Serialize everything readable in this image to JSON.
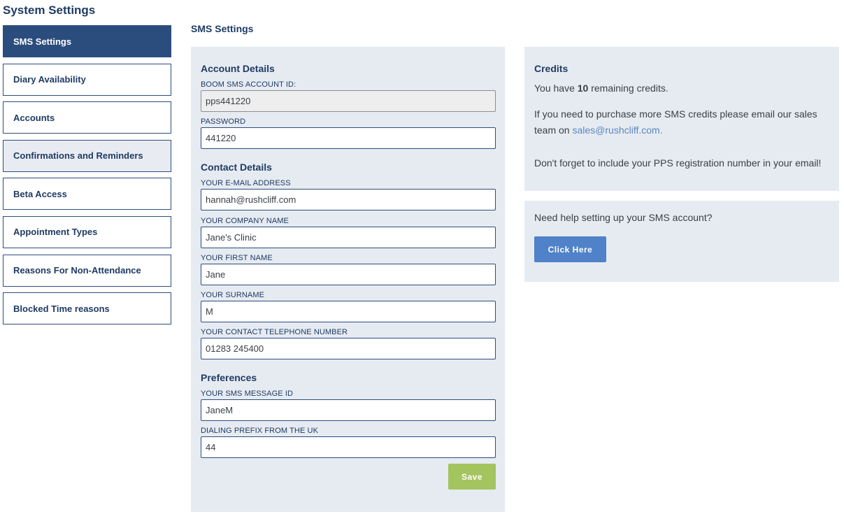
{
  "page": {
    "title": "System Settings"
  },
  "sidebar": {
    "items": [
      {
        "label": "SMS Settings"
      },
      {
        "label": "Diary Availability"
      },
      {
        "label": "Accounts"
      },
      {
        "label": "Confirmations and Reminders"
      },
      {
        "label": "Beta Access"
      },
      {
        "label": "Appointment Types"
      },
      {
        "label": "Reasons For Non-Attendance"
      },
      {
        "label": "Blocked Time reasons"
      }
    ]
  },
  "main": {
    "section_title": "SMS Settings"
  },
  "form": {
    "account_title": "Account Details",
    "account_id_label": "BOOM SMS ACCOUNT ID:",
    "account_id_value": "pps441220",
    "password_label": "PASSWORD",
    "password_value": "441220",
    "contact_title": "Contact Details",
    "email_label": "YOUR E-MAIL ADDRESS",
    "email_value": "hannah@rushcliff.com",
    "company_label": "YOUR COMPANY NAME",
    "company_value": "Jane's Clinic",
    "first_name_label": "YOUR FIRST NAME",
    "first_name_value": "Jane",
    "surname_label": "YOUR SURNAME",
    "surname_value": "M",
    "phone_label": "YOUR CONTACT TELEPHONE NUMBER",
    "phone_value": "01283 245400",
    "preferences_title": "Preferences",
    "sms_id_label": "YOUR SMS MESSAGE ID",
    "sms_id_value": "JaneM",
    "prefix_label": "DIALING PREFIX FROM THE UK",
    "prefix_value": "44",
    "save_label": "Save"
  },
  "credits": {
    "title": "Credits",
    "remaining_prefix": "You have ",
    "remaining_count": "10",
    "remaining_suffix": " remaining credits.",
    "purchase_text": "If you need to purchase more SMS credits please email our sales team on ",
    "email": "sales@rushcliff.com.",
    "reminder": "Don't forget to include your PPS registration number in your email!"
  },
  "help": {
    "question": "Need help setting up your SMS account?",
    "button_label": "Click Here"
  },
  "colors": {
    "primary": "#2b4d7d",
    "panel_bg": "#e6ebf2",
    "save_button": "#a3c45e",
    "help_button": "#4f82c8",
    "link": "#5b86c1"
  }
}
